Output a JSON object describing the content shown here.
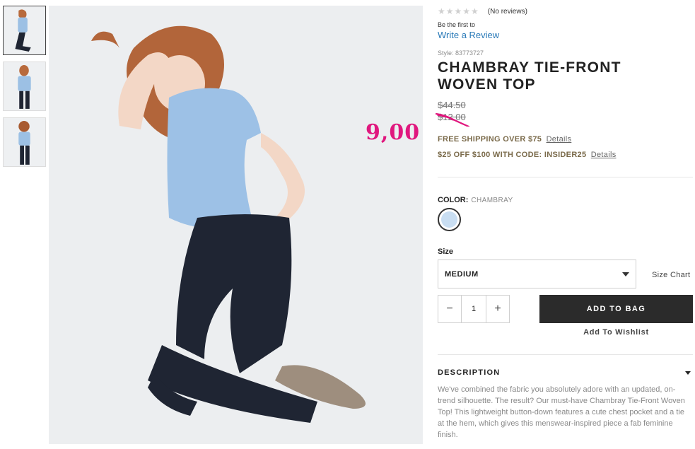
{
  "thumbnails": [
    {
      "label": "thumbnail-1"
    },
    {
      "label": "thumbnail-2"
    },
    {
      "label": "thumbnail-3"
    }
  ],
  "overlay": {
    "handwritten_price": "9,00",
    "color": "#e0177e"
  },
  "rating": {
    "stars": "★★★★★",
    "reviews_text": "(No reviews)"
  },
  "review_prompt": {
    "be_first": "Be the first to",
    "write_review": "Write a Review"
  },
  "product": {
    "style": "Style: 83773727",
    "title": "CHAMBRAY TIE-FRONT WOVEN TOP",
    "price_original": "$44.50",
    "price_sale": "$12.00"
  },
  "promos": [
    {
      "text": "FREE SHIPPING OVER $75",
      "link": "Details"
    },
    {
      "text": "$25 OFF $100 WITH CODE: INSIDER25",
      "link": "Details"
    }
  ],
  "color": {
    "label": "COLOR:",
    "value": "CHAMBRAY",
    "swatch_hex": "#c9def2"
  },
  "size": {
    "label": "Size",
    "selected": "MEDIUM",
    "chart_link": "Size Chart"
  },
  "quantity": {
    "minus": "−",
    "value": "1",
    "plus": "+"
  },
  "actions": {
    "add_to_bag": "ADD TO BAG",
    "wishlist": "Add To Wishlist"
  },
  "description": {
    "heading": "DESCRIPTION",
    "body": "We've combined the fabric you absolutely adore with an updated, on-trend silhouette. The result? Our must-have Chambray Tie-Front Woven Top! This lightweight button-down features a cute chest pocket and a tie at the hem, which gives this menswear-inspired piece a fab feminine finish."
  },
  "colors": {
    "accent_dark": "#2b2b2b",
    "link_blue": "#2a7ab8",
    "promo_text": "#7a6a4a"
  }
}
